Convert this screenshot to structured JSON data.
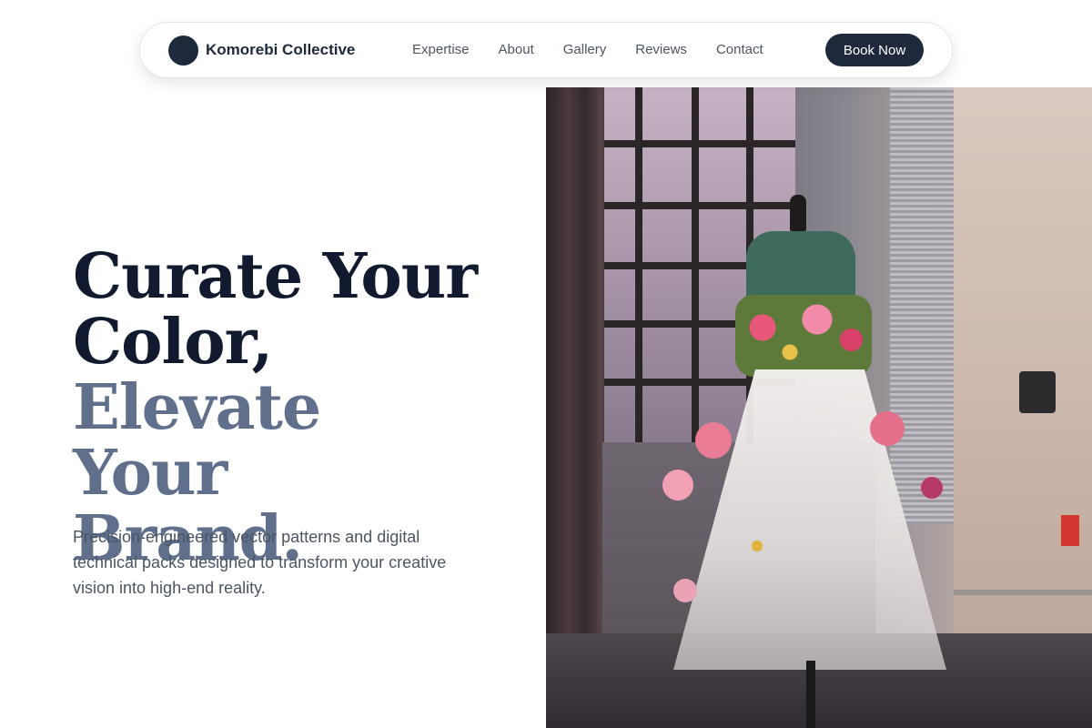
{
  "nav": {
    "brand": "Komorebi Collective",
    "links": [
      "Expertise",
      "About",
      "Gallery",
      "Reviews",
      "Contact"
    ],
    "cta": "Book Now"
  },
  "hero": {
    "headline_line1": "Curate Your",
    "headline_line2": "Color,",
    "headline_line3": "Elevate Your",
    "headline_line4": "Brand.",
    "subcopy": "Precision-engineered vector patterns and digital technical packs designed to transform your creative vision into high-end reality."
  },
  "colors": {
    "primary": "#1e293b",
    "headline_dark": "#111a2e",
    "headline_muted": "#5f6f8c",
    "body_text": "#4b5563"
  }
}
